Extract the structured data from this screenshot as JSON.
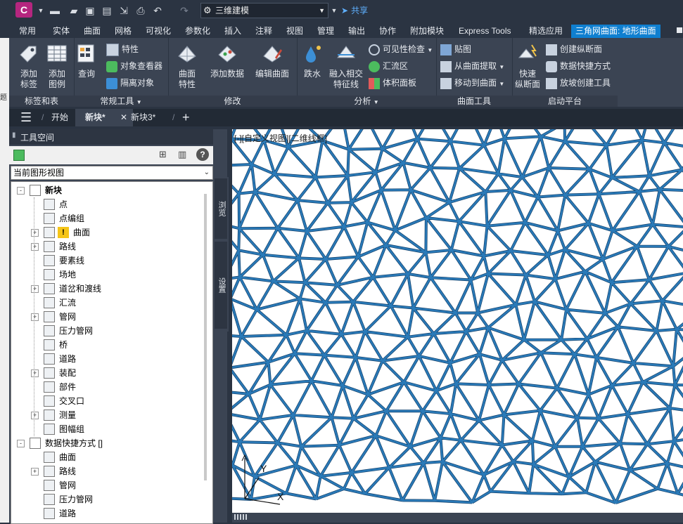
{
  "app": {
    "logo_letter": "C",
    "workspace": "三维建模",
    "share_label": "共享"
  },
  "ribbon_tabs": [
    "常用",
    "实体",
    "曲面",
    "网格",
    "可视化",
    "参数化",
    "插入",
    "注释",
    "视图",
    "管理",
    "输出",
    "协作",
    "附加模块",
    "Express Tools",
    "精选应用",
    "三角网曲面: 地形曲面"
  ],
  "active_tab_index": 15,
  "panels": {
    "labels_tables": {
      "title": "标签和表",
      "add_labels": "添加\n标签",
      "add_legend": "添加\n图例"
    },
    "general_tools": {
      "title": "常规工具",
      "query": "查询",
      "properties": "特性",
      "object_viewer": "对象查看器",
      "isolate": "隔离对象"
    },
    "modify": {
      "title": "修改",
      "surface_props": "曲面\n特性",
      "add_data": "添加数据",
      "edit_surface": "编辑曲面"
    },
    "analyze": {
      "title": "分析",
      "water_drop": "跌水",
      "intersect": "融入相交\n特征线",
      "visibility": "可见性检查",
      "catchment": "汇流区",
      "volume": "体积面板"
    },
    "surface_tools": {
      "title": "曲面工具",
      "drape": "贴图",
      "extract": "从曲面提取",
      "move_to": "移动到曲面"
    },
    "launch_pad": {
      "title": "启动平台",
      "quick_profile": "快速\n纵断面",
      "create_profile": "创建纵断面",
      "data_shortcuts": "数据快捷方式",
      "grading": "放坡创建工具"
    }
  },
  "doc_tabs": {
    "start": "开始",
    "tab1": "新块*",
    "tab2": "新块3*",
    "plus": "+"
  },
  "toolspace": {
    "title": "工具空间",
    "view_select": "当前图形视图",
    "side_tab1": "浏览",
    "side_tab2": "设置",
    "tree": [
      {
        "label": "新块",
        "level": 0,
        "expand": "-",
        "bold": true
      },
      {
        "label": "点",
        "level": 1,
        "expand": ""
      },
      {
        "label": "点编组",
        "level": 1,
        "expand": ""
      },
      {
        "label": "曲面",
        "level": 1,
        "expand": "+",
        "warn": true
      },
      {
        "label": "路线",
        "level": 1,
        "expand": "+"
      },
      {
        "label": "要素线",
        "level": 1,
        "expand": ""
      },
      {
        "label": "场地",
        "level": 1,
        "expand": ""
      },
      {
        "label": "道岔和渡线",
        "level": 1,
        "expand": "+"
      },
      {
        "label": "汇流",
        "level": 1,
        "expand": ""
      },
      {
        "label": "管网",
        "level": 1,
        "expand": "+"
      },
      {
        "label": "压力管网",
        "level": 1,
        "expand": ""
      },
      {
        "label": "桥",
        "level": 1,
        "expand": ""
      },
      {
        "label": "道路",
        "level": 1,
        "expand": ""
      },
      {
        "label": "装配",
        "level": 1,
        "expand": "+"
      },
      {
        "label": "部件",
        "level": 1,
        "expand": ""
      },
      {
        "label": "交叉口",
        "level": 1,
        "expand": ""
      },
      {
        "label": "测量",
        "level": 1,
        "expand": "+"
      },
      {
        "label": "图幅组",
        "level": 1,
        "expand": ""
      },
      {
        "label": "数据快捷方式 []",
        "level": 0,
        "expand": "-"
      },
      {
        "label": "曲面",
        "level": 1,
        "expand": ""
      },
      {
        "label": "路线",
        "level": 1,
        "expand": "+"
      },
      {
        "label": "管网",
        "level": 1,
        "expand": ""
      },
      {
        "label": "压力管网",
        "level": 1,
        "expand": ""
      },
      {
        "label": "道路",
        "level": 1,
        "expand": ""
      }
    ]
  },
  "viewport": {
    "label": "[-][自定义视图][二维线框]",
    "axis_x": "X",
    "axis_y": "Y",
    "mesh_color": "#2a7ab8"
  },
  "left_edge_text": "题"
}
